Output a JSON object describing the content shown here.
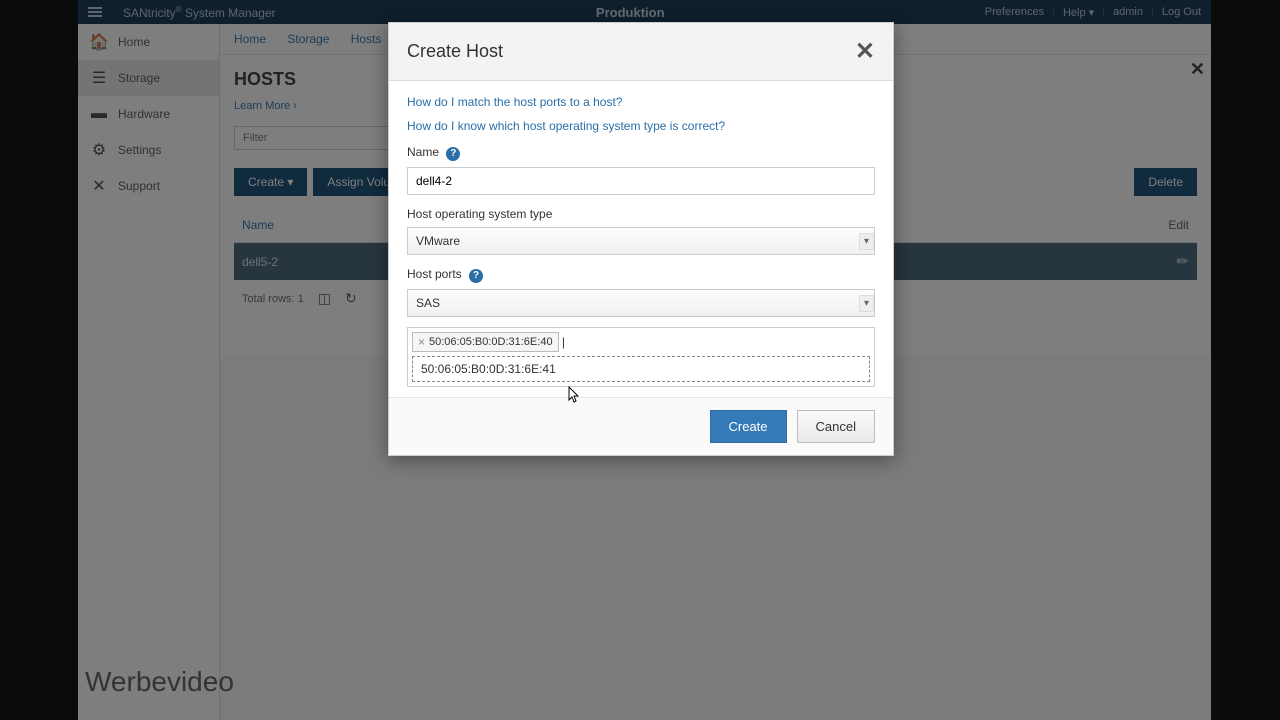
{
  "topbar": {
    "brand_pre": "SANtricity",
    "brand_post": " System Manager",
    "center": "Produktion",
    "prefs": "Preferences",
    "help": "Help",
    "user": "admin",
    "logout": "Log Out"
  },
  "sidebar": {
    "items": [
      {
        "label": "Home"
      },
      {
        "label": "Storage"
      },
      {
        "label": "Hardware"
      },
      {
        "label": "Settings"
      },
      {
        "label": "Support"
      }
    ]
  },
  "breadcrumb": {
    "a": "Home",
    "b": "Storage",
    "c": "Hosts"
  },
  "page": {
    "title": "HOSTS",
    "learn": "Learn More ›",
    "filter_ph": "Filter",
    "create": "Create",
    "assign": "Assign Volumes",
    "delete": "Delete",
    "col_name": "Name",
    "col_edit": "Edit",
    "row_name": "dell5-2",
    "total": "Total rows: 1"
  },
  "modal": {
    "title": "Create Host",
    "link1": "How do I match the host ports to a host?",
    "link2": "How do I know which host operating system type is correct?",
    "name_label": "Name",
    "name_value": "dell4-2",
    "os_label": "Host operating system type",
    "os_value": "VMware",
    "ports_label": "Host ports",
    "ports_proto": "SAS",
    "tag1": "50:06:05:B0:0D:31:6E:40",
    "option1": "50:06:05:B0:0D:31:6E:41",
    "create": "Create",
    "cancel": "Cancel"
  },
  "water": "Werbevideo"
}
